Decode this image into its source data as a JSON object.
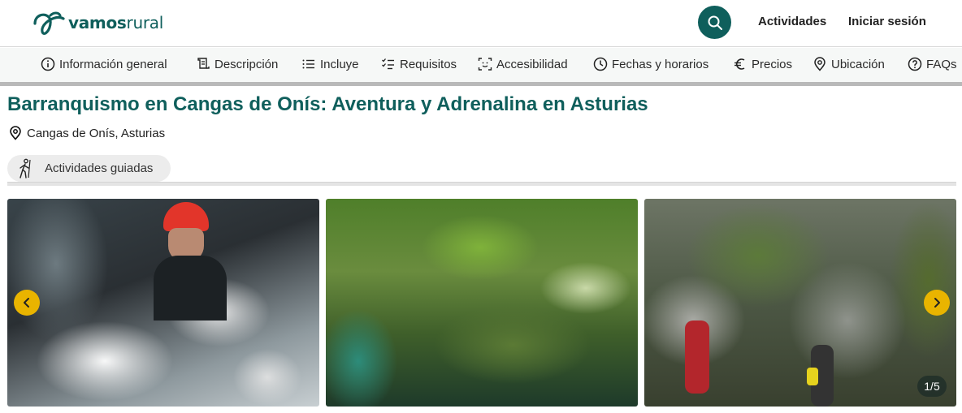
{
  "header": {
    "logo_bold": "vamos",
    "logo_light": "rural",
    "activities_link": "Actividades",
    "login_link": "Iniciar sesión"
  },
  "nav": {
    "items": [
      {
        "label": "Información general",
        "icon": "info-circle-icon"
      },
      {
        "label": "Descripción",
        "icon": "scroll-icon"
      },
      {
        "label": "Incluye",
        "icon": "list-icon"
      },
      {
        "label": "Requisitos",
        "icon": "checklist-icon"
      },
      {
        "label": "Accesibilidad",
        "icon": "face-scan-icon"
      },
      {
        "label": "Fechas y horarios",
        "icon": "clock-icon"
      },
      {
        "label": "Precios",
        "icon": "euro-icon"
      },
      {
        "label": "Ubicación",
        "icon": "location-pin-icon"
      },
      {
        "label": "FAQs",
        "icon": "question-circle-icon"
      }
    ]
  },
  "activity": {
    "title": "Barranquismo en Cangas de Onís: Aventura y Adrenalina en Asturias",
    "location": "Cangas de Onís, Asturias",
    "tag": "Actividades guiadas"
  },
  "gallery": {
    "counter": "1/5",
    "photos": [
      "canyoning-splash-photo",
      "mossy-waterfall-photo",
      "canyon-rocks-photo"
    ]
  },
  "colors": {
    "brand": "#0f5f5c",
    "accent": "#e9b400"
  }
}
